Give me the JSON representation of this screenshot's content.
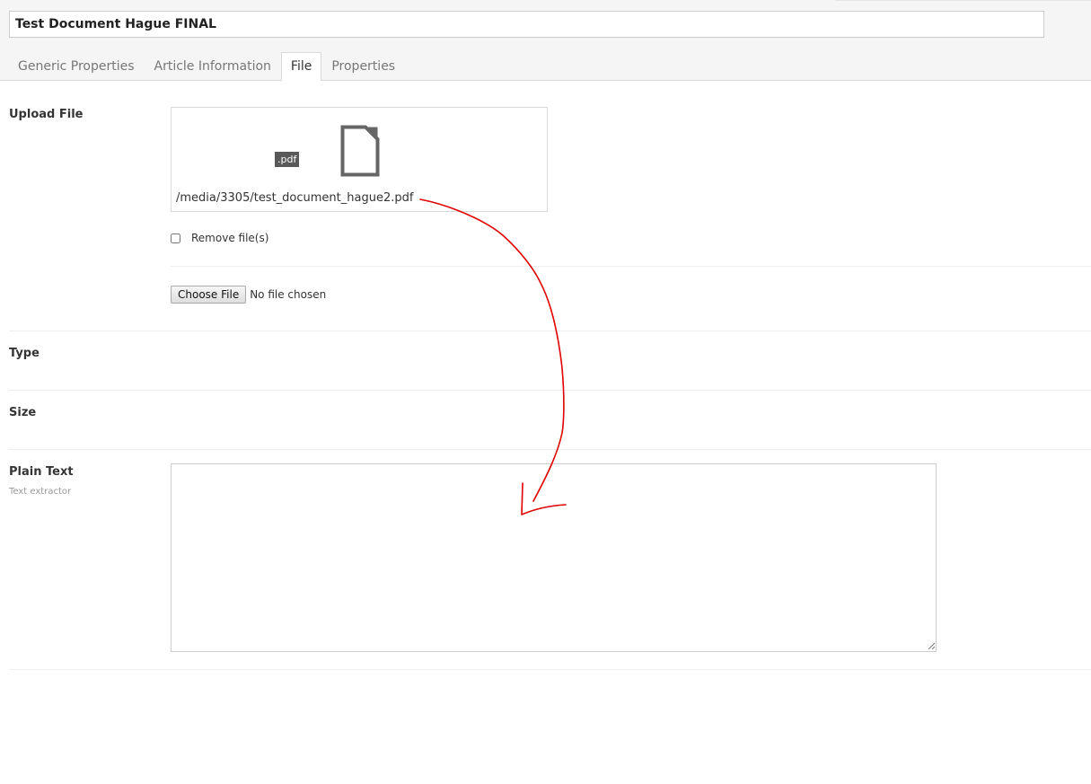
{
  "document": {
    "title": "Test Document Hague FINAL"
  },
  "tabs": [
    {
      "label": "Generic Properties"
    },
    {
      "label": "Article Information"
    },
    {
      "label": "File"
    },
    {
      "label": "Properties"
    }
  ],
  "active_tab": "File",
  "upload": {
    "label": "Upload File",
    "extension_badge": ".pdf",
    "file_path": "/media/3305/test_document_hague2.pdf",
    "icon": "document-icon",
    "remove_label": "Remove file(s)",
    "remove_checked": false,
    "choose_button": "Choose File",
    "no_file_text": "No file chosen"
  },
  "fields": {
    "type_label": "Type",
    "size_label": "Size",
    "plain_text_label": "Plain Text",
    "plain_text_description": "Text extractor",
    "plain_text_value": ""
  },
  "colors": {
    "annotation_arrow": "#e00000",
    "badge_background": "#595959",
    "icon_gray": "#666666"
  }
}
